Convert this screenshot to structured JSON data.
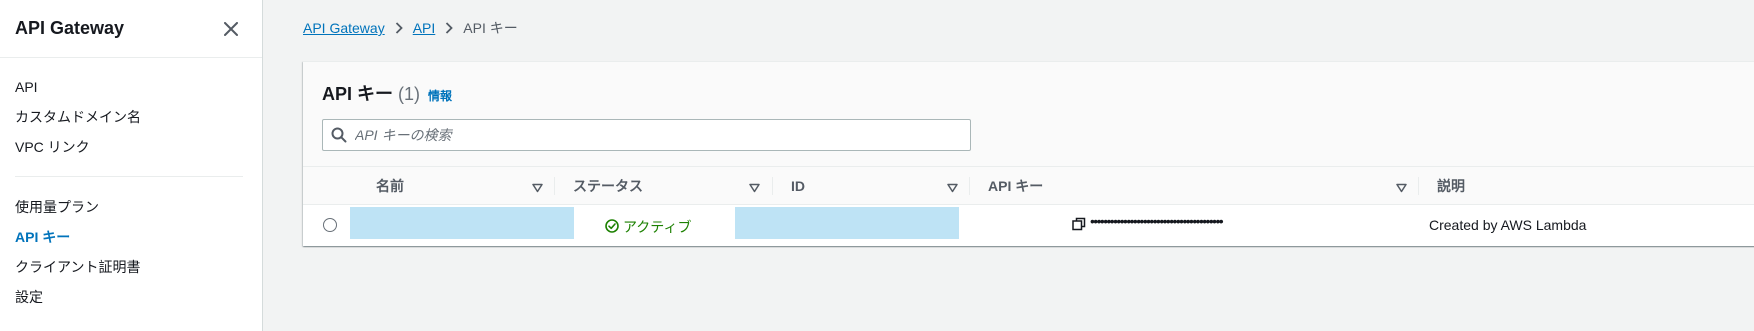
{
  "sidebar": {
    "title": "API Gateway",
    "items_group1": [
      {
        "label": "API"
      },
      {
        "label": "カスタムドメイン名"
      },
      {
        "label": "VPC リンク"
      }
    ],
    "items_group2": [
      {
        "label": "使用量プラン"
      },
      {
        "label": "API キー",
        "active": true
      },
      {
        "label": "クライアント証明書"
      },
      {
        "label": "設定"
      }
    ]
  },
  "breadcrumb": {
    "item1": "API Gateway",
    "item2": "API",
    "current": "API キー"
  },
  "panel": {
    "title": "API キー",
    "count": "(1)",
    "info_link": "情報",
    "search_placeholder": "API キーの検索"
  },
  "table": {
    "columns": [
      "名前",
      "ステータス",
      "ID",
      "API キー",
      "説明"
    ],
    "rows": [
      {
        "name": "",
        "status": "アクティブ",
        "id": "",
        "api_key": "••••••••••••••••••••••••••••••••••••••••",
        "description": "Created by AWS Lambda"
      }
    ]
  },
  "colors": {
    "accent": "#0073bb",
    "status_active": "#1d8102",
    "redaction": "#bee3f5"
  }
}
